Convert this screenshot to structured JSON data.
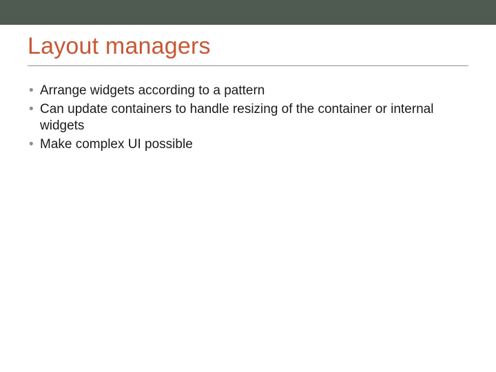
{
  "slide": {
    "title": "Layout managers",
    "bullets": [
      "Arrange widgets according to a pattern",
      "Can update containers to handle resizing of the container or internal widgets",
      "Make complex UI possible"
    ]
  },
  "colors": {
    "accent": "#c65735",
    "top_bar": "#4f5b50",
    "bullet_glyph": "#8b9383"
  }
}
